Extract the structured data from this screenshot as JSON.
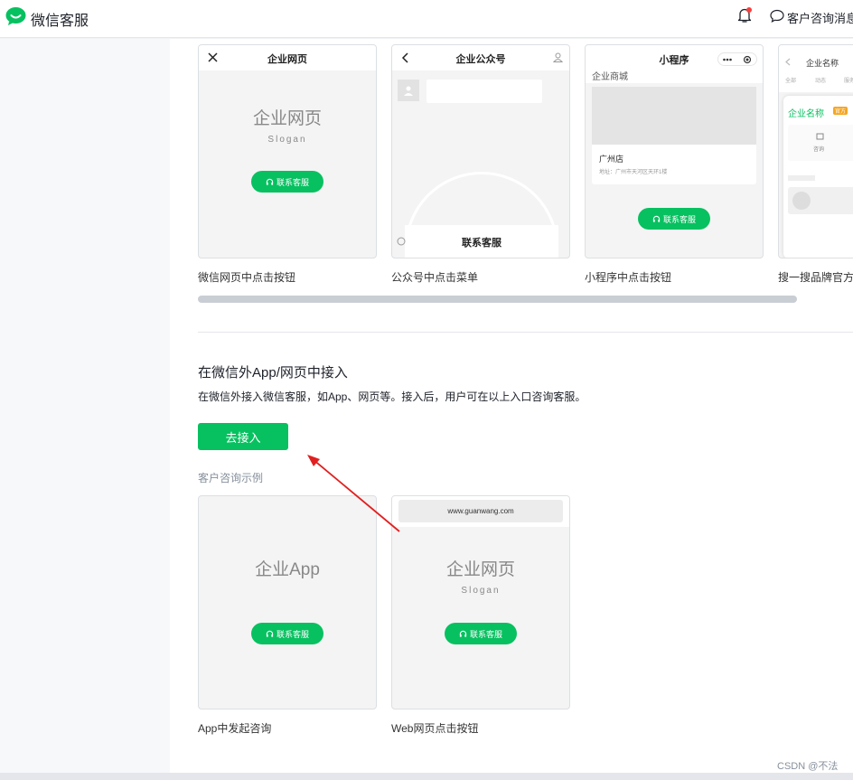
{
  "header": {
    "brand": "微信客服",
    "consult_label": "客户咨询消息"
  },
  "wechat_cards": [
    {
      "title": "企业网页",
      "big_title": "企业网页",
      "slogan": "Slogan",
      "button": "联系客服",
      "caption": "微信网页中点击按钮"
    },
    {
      "title": "企业公众号",
      "menu_label": "联系客服",
      "caption": "公众号中点击菜单"
    },
    {
      "title": "小程序",
      "store_header": "企业商城",
      "store_name": "广州店",
      "store_addr": "地址：广州市天河区天环1楼",
      "button": "联系客服",
      "caption": "小程序中点击按钮"
    },
    {
      "title": "企业名称",
      "tabs": [
        "全部",
        "动态",
        "服务"
      ],
      "brand_name": "企业名称",
      "brand_badge": "官方",
      "entry": "咨询",
      "caption": "搜一搜品牌官方区"
    }
  ],
  "section": {
    "title": "在微信外App/网页中接入",
    "desc": "在微信外接入微信客服，如App、网页等。接入后，用户可在以上入口咨询客服。",
    "button": "去接入",
    "example_label": "客户咨询示例"
  },
  "external_cards": [
    {
      "big_title": "企业App",
      "button": "联系客服",
      "caption": "App中发起咨询"
    },
    {
      "url": "www.guanwang.com",
      "big_title": "企业网页",
      "slogan": "Slogan",
      "button": "联系客服",
      "caption": "Web网页点击按钮"
    }
  ],
  "watermark": "CSDN @不法",
  "colors": {
    "brand_green": "#07c160",
    "annotation_arrow": "#e02020",
    "notification_dot": "#f53f3f"
  }
}
